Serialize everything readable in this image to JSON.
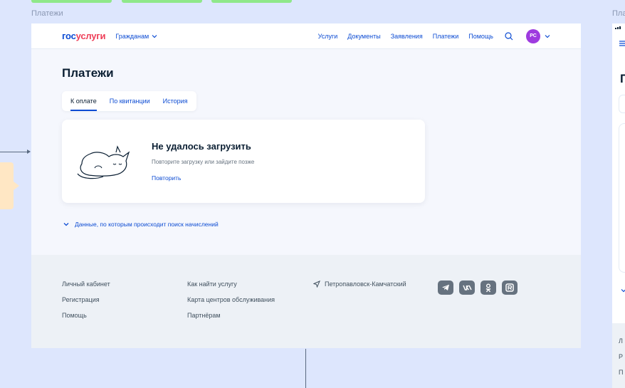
{
  "canvas": {
    "frame_label": "Платежи",
    "frame2_label": "Платежи"
  },
  "header": {
    "logo_part1": "гос",
    "logo_part2": "услуги",
    "citizen_menu": "Гражданам",
    "nav": [
      "Услуги",
      "Документы",
      "Заявления",
      "Платежи",
      "Помощь"
    ],
    "avatar_initials": "РС"
  },
  "page": {
    "title": "Платежи",
    "tabs": [
      {
        "label": "К оплате",
        "active": true
      },
      {
        "label": "По квитанции",
        "active": false
      },
      {
        "label": "История",
        "active": false
      }
    ],
    "error": {
      "title": "Не удалось загрузить",
      "subtitle": "Повторите загрузку или зайдите позже",
      "retry_label": "Повторить"
    },
    "data_link": "Данные, по которым происходит поиск начислений"
  },
  "footer": {
    "col1": [
      "Личный кабинет",
      "Регистрация",
      "Помощь"
    ],
    "col2": [
      "Как найти услугу",
      "Карта центров обслуживания",
      "Партнёрам"
    ],
    "city": "Петропавловск-Камчатский",
    "socials": [
      "telegram-icon",
      "vk-icon",
      "ok-icon",
      "rutube-icon"
    ]
  },
  "frame2": {
    "title_char": "П",
    "footer_chars": [
      "Л",
      "Р",
      "П"
    ]
  },
  "colors": {
    "primary": "#0d4cd3",
    "logo_red": "#ee3f58",
    "avatar": "#9e3bdf",
    "canvas_bg": "#dde6fd"
  }
}
